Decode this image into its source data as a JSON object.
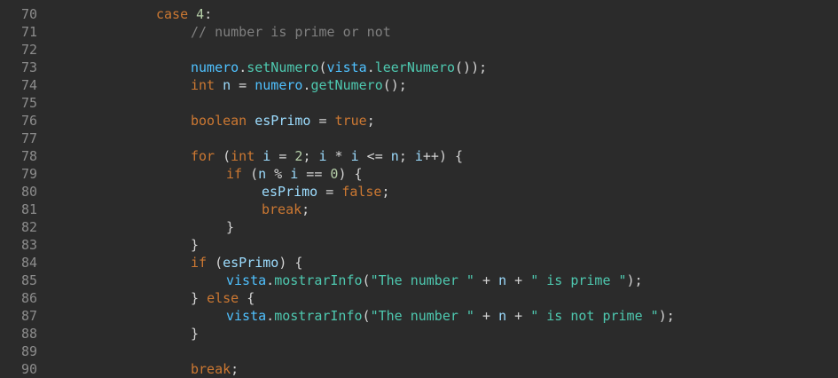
{
  "colors": {
    "background": "#2b2b2b",
    "line_number": "#8c8c8c",
    "keyword": "#cc7832",
    "identifier": "#d4d4d4",
    "variable": "#9cdcfe",
    "object": "#4fc1ff",
    "method": "#4ec9b0",
    "number": "#b5cea8",
    "string": "#4ec9b0",
    "comment": "#808080"
  },
  "editor": {
    "lines": [
      {
        "number": "70",
        "indent": 3,
        "tokens": [
          {
            "t": "case",
            "k": "keyword"
          },
          {
            "t": " ",
            "k": "punct"
          },
          {
            "t": "4",
            "k": "number"
          },
          {
            "t": ":",
            "k": "punct"
          }
        ]
      },
      {
        "number": "71",
        "indent": 4,
        "tokens": [
          {
            "t": "// number is prime or not",
            "k": "comment"
          }
        ]
      },
      {
        "number": "72",
        "indent": 0,
        "tokens": []
      },
      {
        "number": "73",
        "indent": 4,
        "tokens": [
          {
            "t": "numero",
            "k": "obj"
          },
          {
            "t": ".",
            "k": "punct"
          },
          {
            "t": "setNumero",
            "k": "method"
          },
          {
            "t": "(",
            "k": "punct"
          },
          {
            "t": "vista",
            "k": "obj"
          },
          {
            "t": ".",
            "k": "punct"
          },
          {
            "t": "leerNumero",
            "k": "method"
          },
          {
            "t": "());",
            "k": "punct"
          }
        ]
      },
      {
        "number": "74",
        "indent": 4,
        "tokens": [
          {
            "t": "int",
            "k": "type"
          },
          {
            "t": " ",
            "k": "punct"
          },
          {
            "t": "n",
            "k": "var"
          },
          {
            "t": " = ",
            "k": "op"
          },
          {
            "t": "numero",
            "k": "obj"
          },
          {
            "t": ".",
            "k": "punct"
          },
          {
            "t": "getNumero",
            "k": "method"
          },
          {
            "t": "();",
            "k": "punct"
          }
        ]
      },
      {
        "number": "75",
        "indent": 0,
        "tokens": []
      },
      {
        "number": "76",
        "indent": 4,
        "tokens": [
          {
            "t": "boolean",
            "k": "type"
          },
          {
            "t": " ",
            "k": "punct"
          },
          {
            "t": "esPrimo",
            "k": "var"
          },
          {
            "t": " = ",
            "k": "op"
          },
          {
            "t": "true",
            "k": "bool"
          },
          {
            "t": ";",
            "k": "punct"
          }
        ]
      },
      {
        "number": "77",
        "indent": 0,
        "tokens": []
      },
      {
        "number": "78",
        "indent": 4,
        "tokens": [
          {
            "t": "for",
            "k": "keyword"
          },
          {
            "t": " (",
            "k": "punct"
          },
          {
            "t": "int",
            "k": "type"
          },
          {
            "t": " ",
            "k": "punct"
          },
          {
            "t": "i",
            "k": "var"
          },
          {
            "t": " = ",
            "k": "op"
          },
          {
            "t": "2",
            "k": "number"
          },
          {
            "t": "; ",
            "k": "punct"
          },
          {
            "t": "i",
            "k": "var"
          },
          {
            "t": " * ",
            "k": "op"
          },
          {
            "t": "i",
            "k": "var"
          },
          {
            "t": " <= ",
            "k": "op"
          },
          {
            "t": "n",
            "k": "var"
          },
          {
            "t": "; ",
            "k": "punct"
          },
          {
            "t": "i",
            "k": "var"
          },
          {
            "t": "++) {",
            "k": "punct"
          }
        ]
      },
      {
        "number": "79",
        "indent": 5,
        "tokens": [
          {
            "t": "if",
            "k": "keyword"
          },
          {
            "t": " (",
            "k": "punct"
          },
          {
            "t": "n",
            "k": "var"
          },
          {
            "t": " % ",
            "k": "op"
          },
          {
            "t": "i",
            "k": "var"
          },
          {
            "t": " == ",
            "k": "op"
          },
          {
            "t": "0",
            "k": "number"
          },
          {
            "t": ") {",
            "k": "punct"
          }
        ]
      },
      {
        "number": "80",
        "indent": 6,
        "tokens": [
          {
            "t": "esPrimo",
            "k": "var"
          },
          {
            "t": " = ",
            "k": "op"
          },
          {
            "t": "false",
            "k": "bool"
          },
          {
            "t": ";",
            "k": "punct"
          }
        ]
      },
      {
        "number": "81",
        "indent": 6,
        "tokens": [
          {
            "t": "break",
            "k": "keyword"
          },
          {
            "t": ";",
            "k": "punct"
          }
        ]
      },
      {
        "number": "82",
        "indent": 5,
        "tokens": [
          {
            "t": "}",
            "k": "punct"
          }
        ]
      },
      {
        "number": "83",
        "indent": 4,
        "tokens": [
          {
            "t": "}",
            "k": "punct"
          }
        ]
      },
      {
        "number": "84",
        "indent": 4,
        "tokens": [
          {
            "t": "if",
            "k": "keyword"
          },
          {
            "t": " (",
            "k": "punct"
          },
          {
            "t": "esPrimo",
            "k": "var"
          },
          {
            "t": ") {",
            "k": "punct"
          }
        ]
      },
      {
        "number": "85",
        "indent": 5,
        "tokens": [
          {
            "t": "vista",
            "k": "obj"
          },
          {
            "t": ".",
            "k": "punct"
          },
          {
            "t": "mostrarInfo",
            "k": "method"
          },
          {
            "t": "(",
            "k": "punct"
          },
          {
            "t": "\"The number \"",
            "k": "string"
          },
          {
            "t": " + ",
            "k": "op"
          },
          {
            "t": "n",
            "k": "var"
          },
          {
            "t": " + ",
            "k": "op"
          },
          {
            "t": "\" is prime \"",
            "k": "string"
          },
          {
            "t": ");",
            "k": "punct"
          }
        ]
      },
      {
        "number": "86",
        "indent": 4,
        "tokens": [
          {
            "t": "} ",
            "k": "punct"
          },
          {
            "t": "else",
            "k": "keyword"
          },
          {
            "t": " {",
            "k": "punct"
          }
        ]
      },
      {
        "number": "87",
        "indent": 5,
        "tokens": [
          {
            "t": "vista",
            "k": "obj"
          },
          {
            "t": ".",
            "k": "punct"
          },
          {
            "t": "mostrarInfo",
            "k": "method"
          },
          {
            "t": "(",
            "k": "punct"
          },
          {
            "t": "\"The number \"",
            "k": "string"
          },
          {
            "t": " + ",
            "k": "op"
          },
          {
            "t": "n",
            "k": "var"
          },
          {
            "t": " + ",
            "k": "op"
          },
          {
            "t": "\" is not prime \"",
            "k": "string"
          },
          {
            "t": ");",
            "k": "punct"
          }
        ]
      },
      {
        "number": "88",
        "indent": 4,
        "tokens": [
          {
            "t": "}",
            "k": "punct"
          }
        ]
      },
      {
        "number": "89",
        "indent": 0,
        "tokens": []
      },
      {
        "number": "90",
        "indent": 4,
        "tokens": [
          {
            "t": "break",
            "k": "keyword"
          },
          {
            "t": ";",
            "k": "punct"
          }
        ]
      }
    ]
  }
}
